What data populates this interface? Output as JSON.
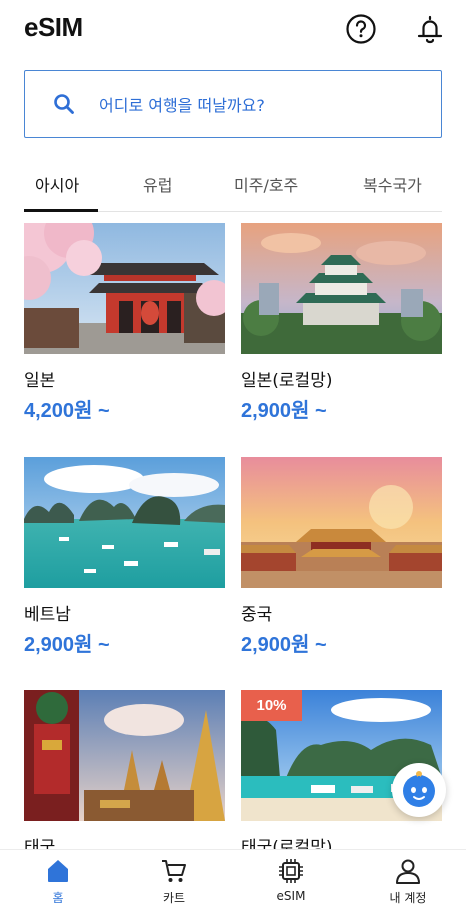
{
  "header": {
    "title": "eSIM",
    "help_icon": "question-circle-icon",
    "notification_icon": "bell-icon"
  },
  "search": {
    "placeholder": "어디로 여행을 떠날까요?",
    "icon": "search-icon"
  },
  "tabs": [
    {
      "label": "아시아",
      "active": true
    },
    {
      "label": "유럽",
      "active": false
    },
    {
      "label": "미주/호주",
      "active": false
    },
    {
      "label": "복수국가",
      "active": false
    }
  ],
  "products": [
    {
      "name": "일본",
      "price": "4,200원 ~",
      "badge": ""
    },
    {
      "name": "일본(로컬망)",
      "price": "2,900원 ~",
      "badge": ""
    },
    {
      "name": "베트남",
      "price": "2,900원 ~",
      "badge": ""
    },
    {
      "name": "중국",
      "price": "2,900원 ~",
      "badge": ""
    },
    {
      "name": "태국",
      "price": "",
      "badge": ""
    },
    {
      "name": "태국(로컬망)",
      "price": "",
      "badge": "10%"
    }
  ],
  "chatbot": {
    "icon": "chatbot-icon"
  },
  "bottom_nav": [
    {
      "label": "홈",
      "icon": "home-icon",
      "active": true
    },
    {
      "label": "카트",
      "icon": "cart-icon",
      "active": false
    },
    {
      "label": "eSIM",
      "icon": "chip-icon",
      "active": false
    },
    {
      "label": "내 계정",
      "icon": "user-icon",
      "active": false
    }
  ],
  "colors": {
    "accent": "#2f74d9",
    "search_border": "#4a86d4",
    "badge": "#e8604c"
  }
}
